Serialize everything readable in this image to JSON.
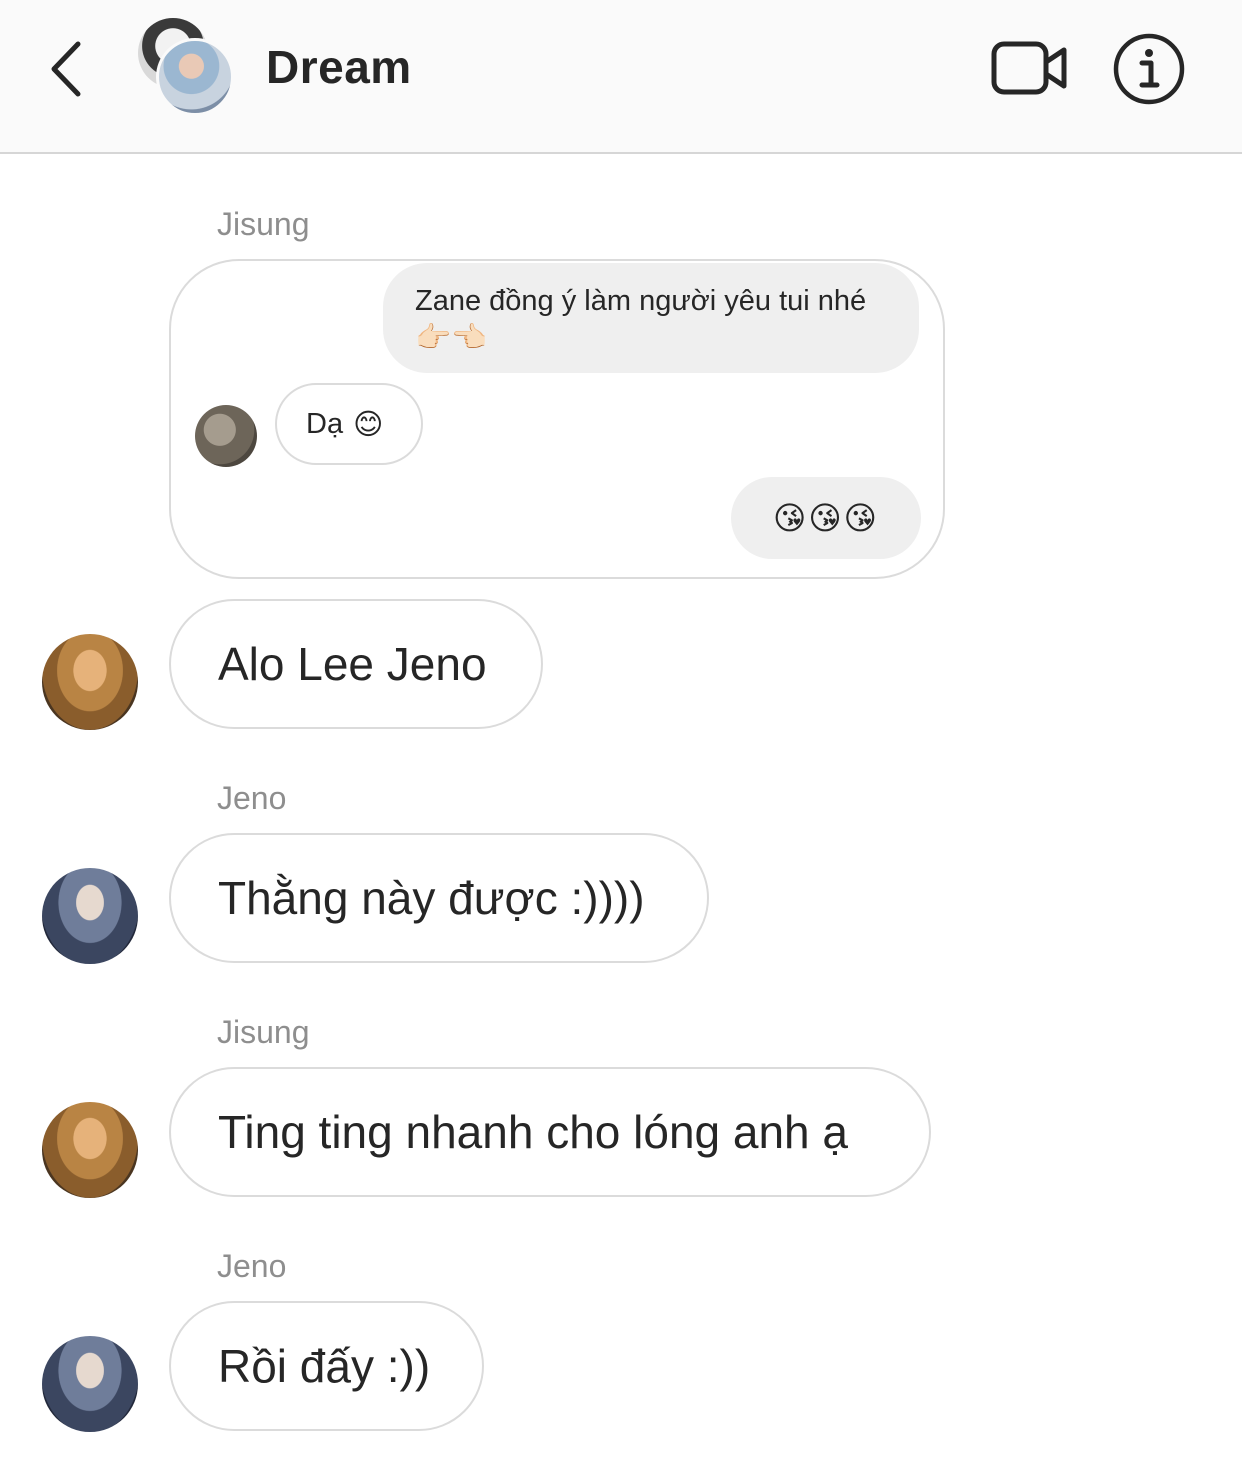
{
  "header": {
    "title": "Dream",
    "back_icon": "chevron-left-icon",
    "video_icon": "video-camera-icon",
    "info_icon": "info-icon"
  },
  "reply": {
    "sender": "Jisung",
    "quoted": [
      {
        "text": "Zane đồng ý làm người yêu tui nhé",
        "emoji": "👉🏻👈🏻",
        "side": "right"
      },
      {
        "text": "Dạ",
        "emoji": "😊",
        "side": "left"
      },
      {
        "text": "😘😘😘",
        "side": "right"
      }
    ],
    "message": "Alo Lee Jeno"
  },
  "messages": [
    {
      "sender": "Jeno",
      "text": "Thằng này được :))))"
    },
    {
      "sender": "Jisung",
      "text": "Ting ting nhanh cho lóng anh ạ"
    },
    {
      "sender": "Jeno",
      "text": "Rồi đấy :))"
    }
  ],
  "colors": {
    "header_bg": "#fafafa",
    "bubble_border": "#dbdbdb",
    "quoted_bg": "#efefef",
    "sender_label": "#8e8e8e",
    "text": "#262626"
  }
}
